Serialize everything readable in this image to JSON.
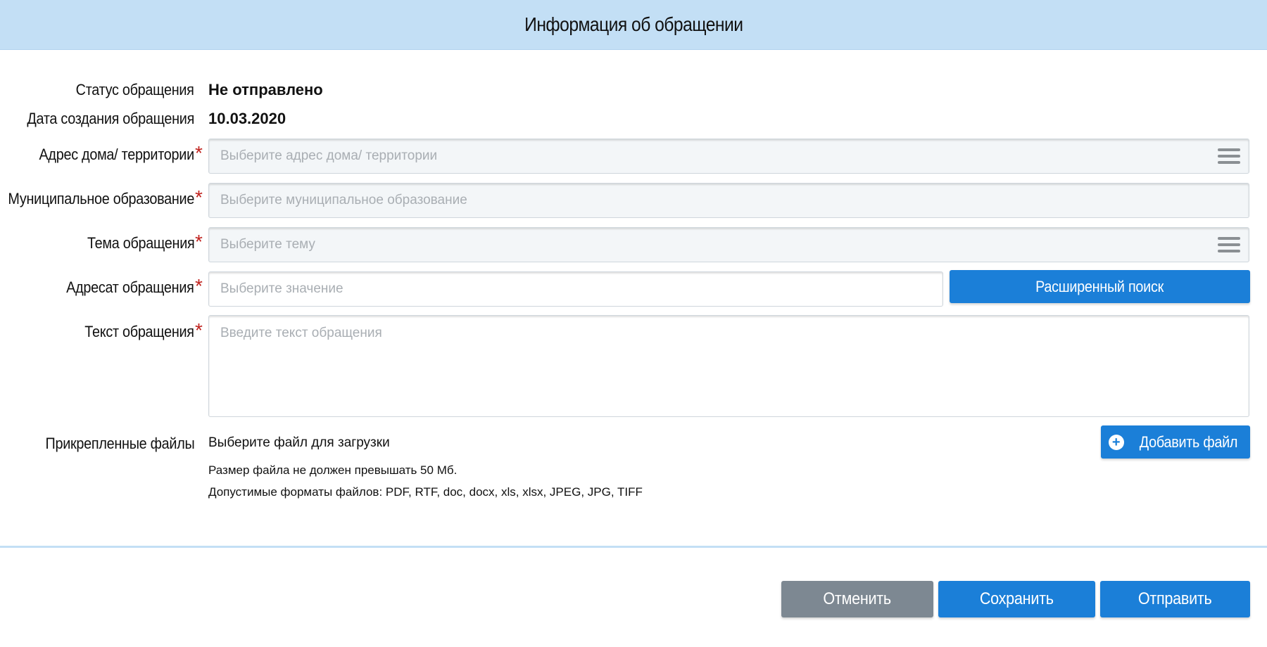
{
  "header": {
    "title": "Информация об обращении"
  },
  "status": {
    "label": "Статус обращения",
    "value": "Не отправлено"
  },
  "created": {
    "label": "Дата создания обращения",
    "value": "10.03.2020"
  },
  "fields": {
    "address": {
      "label": "Адрес дома/ территории",
      "placeholder": "Выберите адрес дома/ территории",
      "required": true
    },
    "municipality": {
      "label": "Муниципальное образование",
      "placeholder": "Выберите муниципальное образование",
      "required": true
    },
    "topic": {
      "label": "Тема обращения",
      "placeholder": "Выберите тему",
      "required": true
    },
    "recipient": {
      "label": "Адресат обращения",
      "placeholder": "Выберите значение",
      "required": true
    },
    "text": {
      "label": "Текст обращения",
      "placeholder": "Введите текст обращения",
      "required": true
    }
  },
  "required_mark": "*",
  "advanced_search_label": "Расширенный поиск",
  "attachments": {
    "label": "Прикрепленные файлы",
    "choose_text": "Выберите файл для загрузки",
    "size_note": "Размер файла не должен превышать 50 Мб.",
    "formats_note": "Допустимые форматы файлов: PDF, RTF, doc, docx, xls, xlsx, JPEG, JPG, TIFF",
    "add_label": "Добавить файл"
  },
  "footer": {
    "cancel_label": "Отменить",
    "save_label": "Сохранить",
    "send_label": "Отправить"
  },
  "colors": {
    "header_bg": "#c3dff5",
    "primary": "#1b7fd8",
    "secondary": "#7d8892",
    "required": "#c0231f"
  },
  "icons": {
    "menu": "hamburger-menu-icon",
    "add": "plus-circle-icon"
  }
}
